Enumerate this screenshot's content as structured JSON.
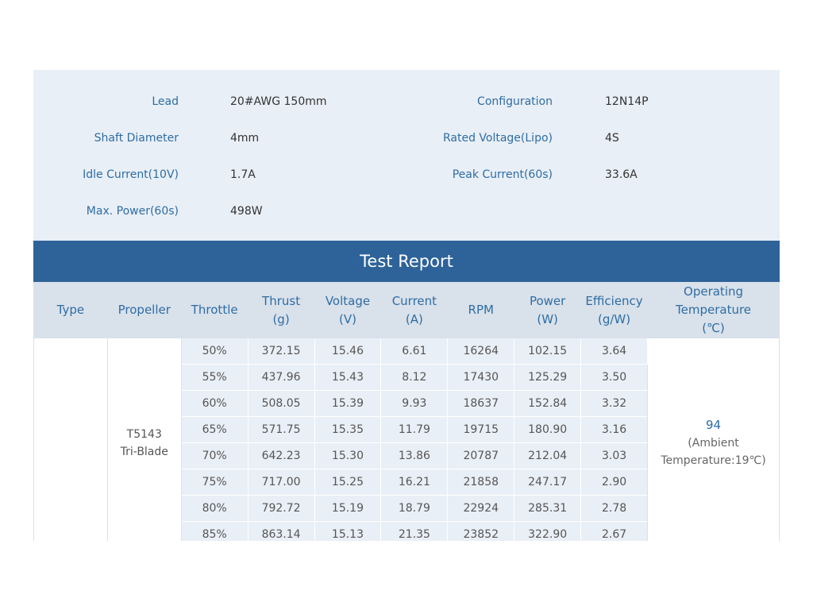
{
  "specs": [
    {
      "label": "Lead",
      "value": "20#AWG 150mm"
    },
    {
      "label": "Configuration",
      "value": "12N14P"
    },
    {
      "label": "Shaft Diameter",
      "value": "4mm"
    },
    {
      "label": "Rated Voltage(Lipo)",
      "value": "4S"
    },
    {
      "label": "Idle Current(10V)",
      "value": "1.7A"
    },
    {
      "label": "Peak Current(60s)",
      "value": "33.6A"
    },
    {
      "label": "Max. Power(60s)",
      "value": "498W"
    }
  ],
  "report": {
    "title": "Test Report",
    "headers": {
      "type": "Type",
      "propeller": "Propeller",
      "throttle": "Throttle",
      "thrust": [
        "Thrust",
        "(g)"
      ],
      "voltage": [
        "Voltage",
        "(V)"
      ],
      "current": [
        "Current",
        "(A)"
      ],
      "rpm": "RPM",
      "power": [
        "Power",
        "(W)"
      ],
      "efficiency": [
        "Efficiency",
        "(g/W)"
      ],
      "temperature": [
        "Operating",
        "Temperature",
        "(℃)"
      ]
    },
    "type": "",
    "propeller": [
      "T5143",
      "Tri-Blade"
    ],
    "temperature": {
      "value": "94",
      "note": [
        "(Ambient",
        "Temperature:19℃)"
      ]
    },
    "rows": [
      [
        "50%",
        "372.15",
        "15.46",
        "6.61",
        "16264",
        "102.15",
        "3.64"
      ],
      [
        "55%",
        "437.96",
        "15.43",
        "8.12",
        "17430",
        "125.29",
        "3.50"
      ],
      [
        "60%",
        "508.05",
        "15.39",
        "9.93",
        "18637",
        "152.84",
        "3.32"
      ],
      [
        "65%",
        "571.75",
        "15.35",
        "11.79",
        "19715",
        "180.90",
        "3.16"
      ],
      [
        "70%",
        "642.23",
        "15.30",
        "13.86",
        "20787",
        "212.04",
        "3.03"
      ],
      [
        "75%",
        "717.00",
        "15.25",
        "16.21",
        "21858",
        "247.17",
        "2.90"
      ],
      [
        "80%",
        "792.72",
        "15.19",
        "18.79",
        "22924",
        "285.31",
        "2.78"
      ],
      [
        "85%",
        "863.14",
        "15.13",
        "21.35",
        "23852",
        "322.90",
        "2.67"
      ]
    ]
  }
}
